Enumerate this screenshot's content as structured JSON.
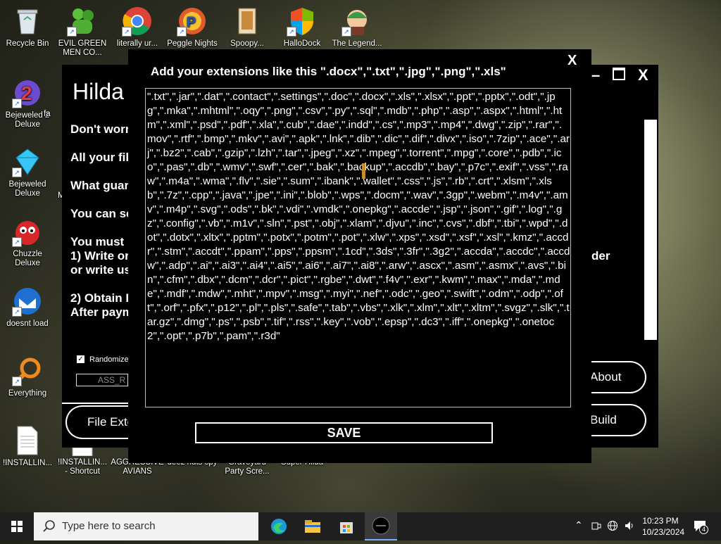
{
  "desktop": {
    "icons": [
      {
        "label": "Recycle Bin",
        "icon": "recycle-bin-icon"
      },
      {
        "label": "EVIL GREEN MEN CO...",
        "icon": "green-men-icon"
      },
      {
        "label": "literally ur...",
        "icon": "chrome-icon"
      },
      {
        "label": "Peggle Nights",
        "icon": "peggle-icon"
      },
      {
        "label": "Spoopy...",
        "icon": "spoopy-icon"
      },
      {
        "label": "HalloDock",
        "icon": "shield-icon"
      },
      {
        "label": "The Legend...",
        "icon": "legend-icon"
      },
      {
        "label": "Bejeweled 2 Deluxe",
        "icon": "bejeweled2-icon"
      },
      {
        "label": "fa",
        "icon": "file-icon"
      },
      {
        "label": "Bejeweled Deluxe",
        "icon": "bejeweled-icon"
      },
      {
        "label": "M",
        "icon": "file-icon"
      },
      {
        "label": "Chuzzle Deluxe",
        "icon": "chuzzle-icon"
      },
      {
        "label": "doesnt load",
        "icon": "thunderbird-icon"
      },
      {
        "label": "Everything",
        "icon": "everything-search-icon"
      },
      {
        "label": "!INSTALLIN...",
        "icon": "text-file-icon"
      },
      {
        "label": "!INSTALLIN... - Shortcut",
        "icon": "shortcut-file-icon"
      },
      {
        "label": "AGGRESSIVE AVIANS",
        "icon": "game-icon"
      },
      {
        "label": "deez nuts spy",
        "icon": "game-icon"
      },
      {
        "label": "Graveyard Party Scre...",
        "icon": "game-icon"
      },
      {
        "label": "Super Hilda",
        "icon": "game-icon"
      }
    ]
  },
  "back_window": {
    "title": "Hilda",
    "controls": {
      "minimize": "–",
      "maximize": "□",
      "close": "X"
    },
    "lines": [
      "Don't worr",
      "All your file",
      "What guar",
      "You can se",
      "You must",
      "1) Write or",
      "or write us",
      "2) Obtain I",
      "After paym"
    ],
    "right_text": "der",
    "randomize_label": "Randomize",
    "randomize_checked": true,
    "name_input_value": "ASS_R",
    "file_ext_button": "File Exter",
    "about_button": "About",
    "build_button": "Build"
  },
  "dialog": {
    "title": "Add your extensions like this     \".docx\",\".txt\",\".jpg\",\".png\",\".xls\"",
    "close": "X",
    "extensions_text": "\".txt\",\".jar\",\".dat\",\".contact\",\".settings\",\".doc\",\".docx\",\".xls\",\".xlsx\",\".ppt\",\".pptx\",\".odt\",\".jpg\",\".mka\",\".mhtml\",\".oqy\",\".png\",\".csv\",\".py\",\".sql\",\".mdb\",\".php\",\".asp\",\".aspx\",\".html\",\".htm\",\".xml\",\".psd\",\".pdf\",\".xla\",\".cub\",\".dae\",\".indd\",\".cs\",\".mp3\",\".mp4\",\".dwg\",\".zip\",\".rar\",\".mov\",\".rtf\",\".bmp\",\".mkv\",\".avi\",\".apk\",\".lnk\",\".dib\",\".dic\",\".dif\",\".divx\",\".iso\",\".7zip\",\".ace\",\".arj\",\".bz2\",\".cab\",\".gzip\",\".lzh\",\".tar\",\".jpeg\",\".xz\",\".mpeg\",\".torrent\",\".mpg\",\".core\",\".pdb\",\".ico\",\".pas\",\".db\",\".wmv\",\".swf\",\".cer\",\".bak\",\".backup\",\".accdb\",\".bay\",\".p7c\",\".exif\",\".vss\",\".raw\",\".m4a\",\".wma\",\".flv\",\".sie\",\".sum\",\".ibank\",\".wallet\",\".css\",\".js\",\".rb\",\".crt\",\".xlsm\",\".xlsb\",\".7z\",\".cpp\",\".java\",\".jpe\",\".ini\",\".blob\",\".wps\",\".docm\",\".wav\",\".3gp\",\".webm\",\".m4v\",\".amv\",\".m4p\",\".svg\",\".ods\",\".bk\",\".vdi\",\".vmdk\",\".onepkg\",\".accde\",\".jsp\",\".json\",\".gif\",\".log\",\".gz\",\".config\",\".vb\",\".m1v\",\".sln\",\".pst\",\".obj\",\".xlam\",\".djvu\",\".inc\",\".cvs\",\".dbf\",\".tbi\",\".wpd\",\".dot\",\".dotx\",\".xltx\",\".pptm\",\".potx\",\".potm\",\".pot\",\".xlw\",\".xps\",\".xsd\",\".xsf\",\".xsl\",\".kmz\",\".accdr\",\".stm\",\".accdt\",\".ppam\",\".pps\",\".ppsm\",\".1cd\",\".3ds\",\".3fr\",\".3g2\",\".accda\",\".accdc\",\".accdw\",\".adp\",\".ai\",\".ai3\",\".ai4\",\".ai5\",\".ai6\",\".ai7\",\".ai8\",\".arw\",\".ascx\",\".asm\",\".asmx\",\".avs\",\".bin\",\".cfm\",\".dbx\",\".dcm\",\".dcr\",\".pict\",\".rgbe\",\".dwt\",\".f4v\",\".exr\",\".kwm\",\".max\",\".mda\",\".mde\",\".mdf\",\".mdw\",\".mht\",\".mpv\",\".msg\",\".myi\",\".nef\",\".odc\",\".geo\",\".swift\",\".odm\",\".odp\",\".oft\",\".orf\",\".pfx\",\".p12\",\".pl\",\".pls\",\".safe\",\".tab\",\".vbs\",\".xlk\",\".xlm\",\".xlt\",\".xltm\",\".svgz\",\".slk\",\".tar.gz\",\".dmg\",\".ps\",\".psb\",\".tif\",\".rss\",\".key\",\".vob\",\".epsp\",\".dc3\",\".iff\",\".onepkg\",\".onetoc2\",\".opt\",\".p7b\",\".pam\",\".r3d\"",
    "save_button": "SAVE"
  },
  "taskbar": {
    "search_placeholder": "Type here to search",
    "pinned": [
      "edge-icon",
      "file-explorer-icon",
      "store-icon",
      "chaos-app-icon"
    ],
    "time": "10:23 PM",
    "date": "10/23/2024",
    "notification_count": "4"
  }
}
